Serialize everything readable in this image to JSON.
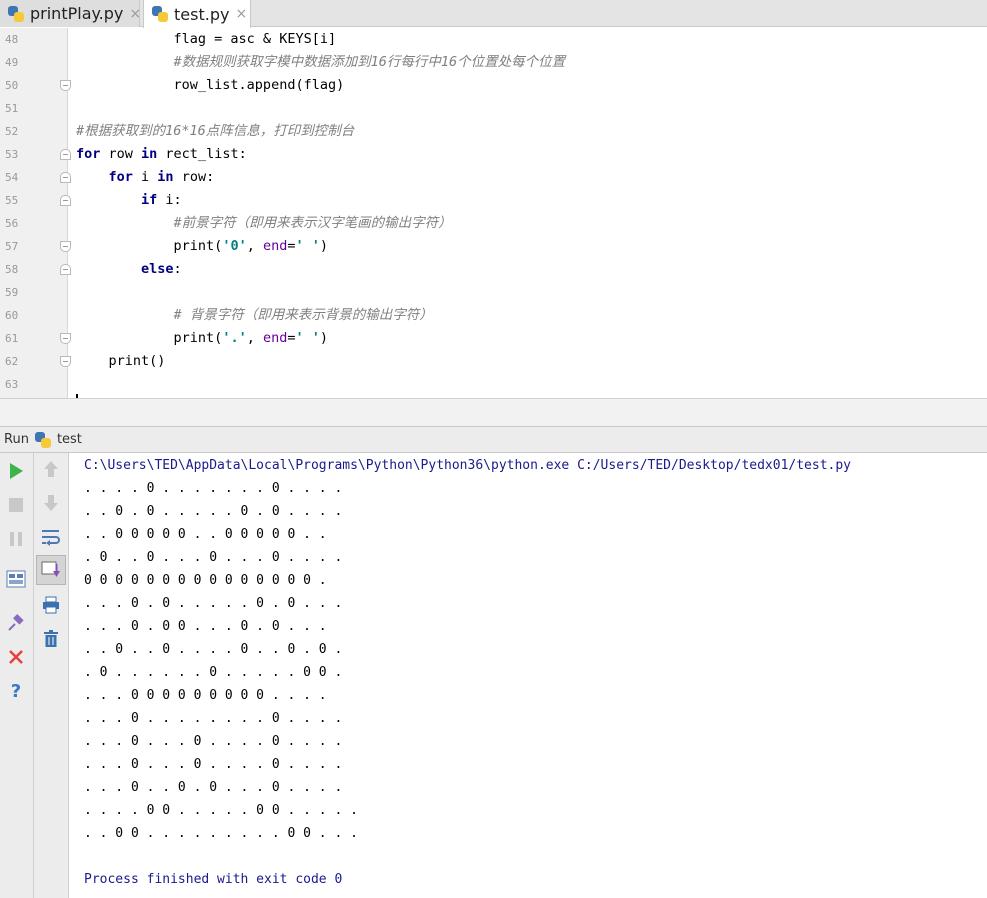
{
  "tabs": [
    {
      "label": "printPlay.py",
      "close": "×",
      "active": false
    },
    {
      "label": "test.py",
      "close": "×",
      "active": true
    }
  ],
  "editor": {
    "lines": [
      {
        "num": "48",
        "segments": [
          {
            "t": "            flag = asc & KEYS[i]",
            "c": ""
          }
        ]
      },
      {
        "num": "49",
        "segments": [
          {
            "t": "            #数据规则获取字模中数据添加到16行每行中16个位置处每个位置",
            "c": "cm"
          }
        ]
      },
      {
        "num": "50",
        "segments": [
          {
            "t": "            row_list.append(flag)",
            "c": ""
          }
        ]
      },
      {
        "num": "51",
        "segments": []
      },
      {
        "num": "52",
        "segments": [
          {
            "t": "#根据获取到的16*16点阵信息，打印到控制台",
            "c": "cm"
          }
        ]
      },
      {
        "num": "53",
        "segments": [
          {
            "t": "for",
            "c": "kw"
          },
          {
            "t": " row ",
            "c": ""
          },
          {
            "t": "in",
            "c": "kw"
          },
          {
            "t": " rect_list:",
            "c": ""
          }
        ]
      },
      {
        "num": "54",
        "segments": [
          {
            "t": "    ",
            "c": ""
          },
          {
            "t": "for",
            "c": "kw"
          },
          {
            "t": " i ",
            "c": ""
          },
          {
            "t": "in",
            "c": "kw"
          },
          {
            "t": " row:",
            "c": ""
          }
        ]
      },
      {
        "num": "55",
        "segments": [
          {
            "t": "        ",
            "c": ""
          },
          {
            "t": "if",
            "c": "kw"
          },
          {
            "t": " i:",
            "c": ""
          }
        ]
      },
      {
        "num": "56",
        "segments": [
          {
            "t": "            #前景字符（即用来表示汉字笔画的输出字符）",
            "c": "cm"
          }
        ]
      },
      {
        "num": "57",
        "segments": [
          {
            "t": "            print(",
            "c": ""
          },
          {
            "t": "'0'",
            "c": "str"
          },
          {
            "t": ", ",
            "c": ""
          },
          {
            "t": "end",
            "c": "kwarg"
          },
          {
            "t": "=",
            "c": ""
          },
          {
            "t": "' '",
            "c": "str"
          },
          {
            "t": ")",
            "c": ""
          }
        ]
      },
      {
        "num": "58",
        "segments": [
          {
            "t": "        ",
            "c": ""
          },
          {
            "t": "else",
            "c": "kw"
          },
          {
            "t": ":",
            "c": ""
          }
        ]
      },
      {
        "num": "59",
        "segments": []
      },
      {
        "num": "60",
        "segments": [
          {
            "t": "            # 背景字符（即用来表示背景的输出字符）",
            "c": "cm"
          }
        ]
      },
      {
        "num": "61",
        "segments": [
          {
            "t": "            print(",
            "c": ""
          },
          {
            "t": "'.'",
            "c": "str"
          },
          {
            "t": ", ",
            "c": ""
          },
          {
            "t": "end",
            "c": "kwarg"
          },
          {
            "t": "=",
            "c": ""
          },
          {
            "t": "' '",
            "c": "str"
          },
          {
            "t": ")",
            "c": ""
          }
        ]
      },
      {
        "num": "62",
        "segments": [
          {
            "t": "    print()",
            "c": ""
          }
        ]
      },
      {
        "num": "63",
        "segments": []
      }
    ]
  },
  "run": {
    "label": "Run",
    "config": "test"
  },
  "console": {
    "command": "C:\\Users\\TED\\AppData\\Local\\Programs\\Python\\Python36\\python.exe C:/Users/TED/Desktop/tedx01/test.py",
    "output": [
      ". . . . 0 . . . . . . . 0 . . . .",
      ". . 0 . 0 . . . . . 0 . 0 . . . .",
      ". . 0 0 0 0 0 . . 0 0 0 0 0 . .",
      ". 0 . . 0 . . . 0 . . . 0 . . . .",
      "0 0 0 0 0 0 0 0 0 0 0 0 0 0 0 .",
      ". . . 0 . 0 . . . . . 0 . 0 . . .",
      ". . . 0 . 0 0 . . . 0 . 0 . . .",
      ". . 0 . . 0 . . . . 0 . . 0 . 0 .",
      ". 0 . . . . . . 0 . . . . . 0 0 .",
      ". . . 0 0 0 0 0 0 0 0 0 . . . .",
      ". . . 0 . . . . . . . . 0 . . . .",
      ". . . 0 . . . 0 . . . . 0 . . . .",
      ". . . 0 . . . 0 . . . . 0 . . . .",
      ". . . 0 . . 0 . 0 . . . 0 . . . .",
      ". . . . 0 0 . . . . . 0 0 . . . . .",
      ". . 0 0 . . . . . . . . . 0 0 . . ."
    ],
    "exit_message": "Process finished with exit code 0"
  },
  "icons": {
    "run": "play-icon",
    "stop": "stop-icon",
    "pause": "pause-icon",
    "layout": "layout-icon",
    "pin": "pin-icon",
    "close": "close-icon",
    "help": "help-icon",
    "up": "up-arrow-icon",
    "down": "down-arrow-icon",
    "softwrap": "soft-wrap-icon",
    "scroll": "scroll-to-end-icon",
    "print": "print-icon",
    "trash": "trash-icon"
  },
  "colors": {
    "keyword": "#000080",
    "comment": "#808080",
    "string": "#008080",
    "console_path": "#1a1a8c",
    "run_green": "#3cb44b",
    "close_red": "#e0433b"
  }
}
